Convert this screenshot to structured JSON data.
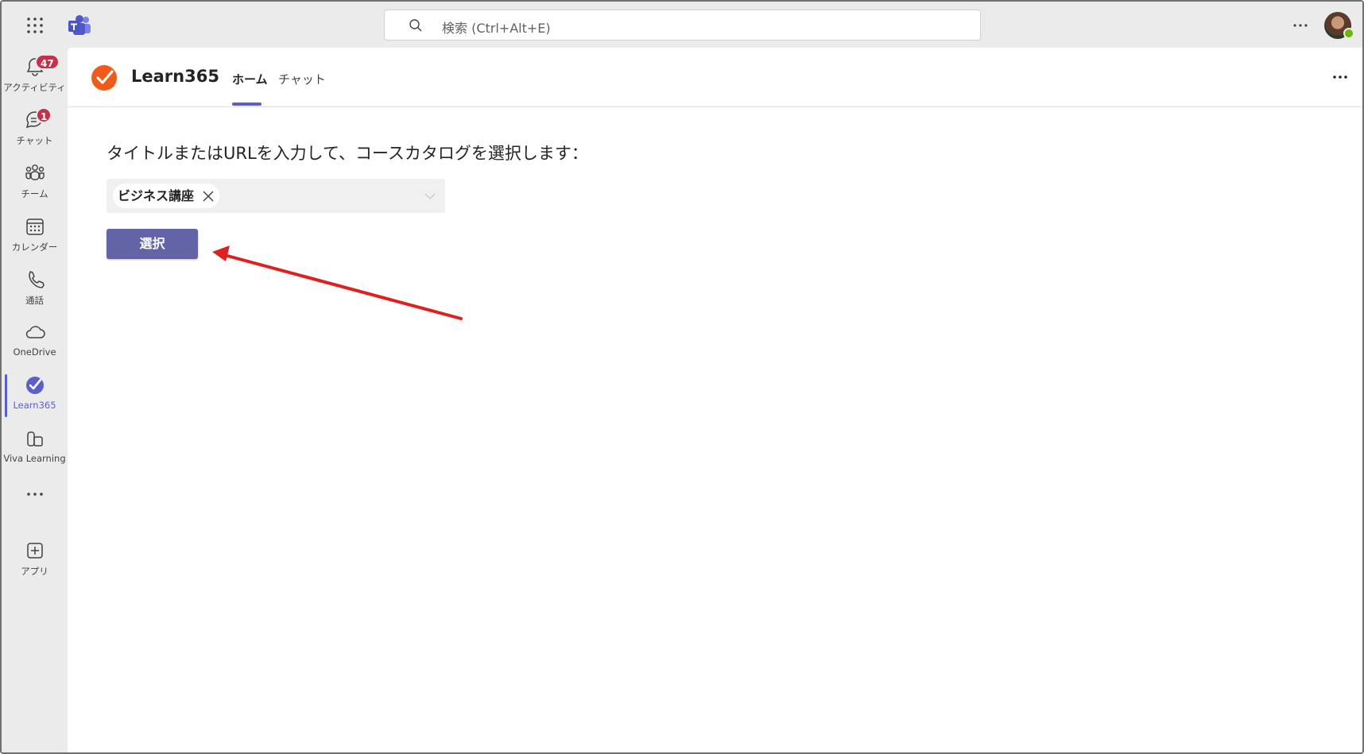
{
  "search": {
    "placeholder": "検索 (Ctrl+Alt+E)"
  },
  "rail": {
    "items": [
      {
        "label": "アクティビティ",
        "icon": "bell-icon",
        "badge": "47"
      },
      {
        "label": "チャット",
        "icon": "chat-icon",
        "badge": "1"
      },
      {
        "label": "チーム",
        "icon": "teams-icon"
      },
      {
        "label": "カレンダー",
        "icon": "calendar-icon"
      },
      {
        "label": "通話",
        "icon": "phone-icon"
      },
      {
        "label": "OneDrive",
        "icon": "cloud-icon"
      },
      {
        "label": "Learn365",
        "icon": "learn365-icon",
        "active": true
      },
      {
        "label": "Viva Learning",
        "icon": "viva-learning-icon"
      },
      {
        "label": "アプリ",
        "icon": "add-app-icon"
      }
    ]
  },
  "app": {
    "title": "Learn365",
    "tabs": [
      {
        "label": "ホーム",
        "selected": true
      },
      {
        "label": "チャット"
      }
    ]
  },
  "content": {
    "prompt": "タイトルまたはURLを入力して、コースカタログを選択します：",
    "selected_chip": "ビジネス講座",
    "select_button": "選択"
  },
  "colors": {
    "accent": "#5b5fc7",
    "button": "#6264a7",
    "arrow": "#e02020",
    "badge": "#c4314b",
    "logo": "#f05a1a"
  }
}
